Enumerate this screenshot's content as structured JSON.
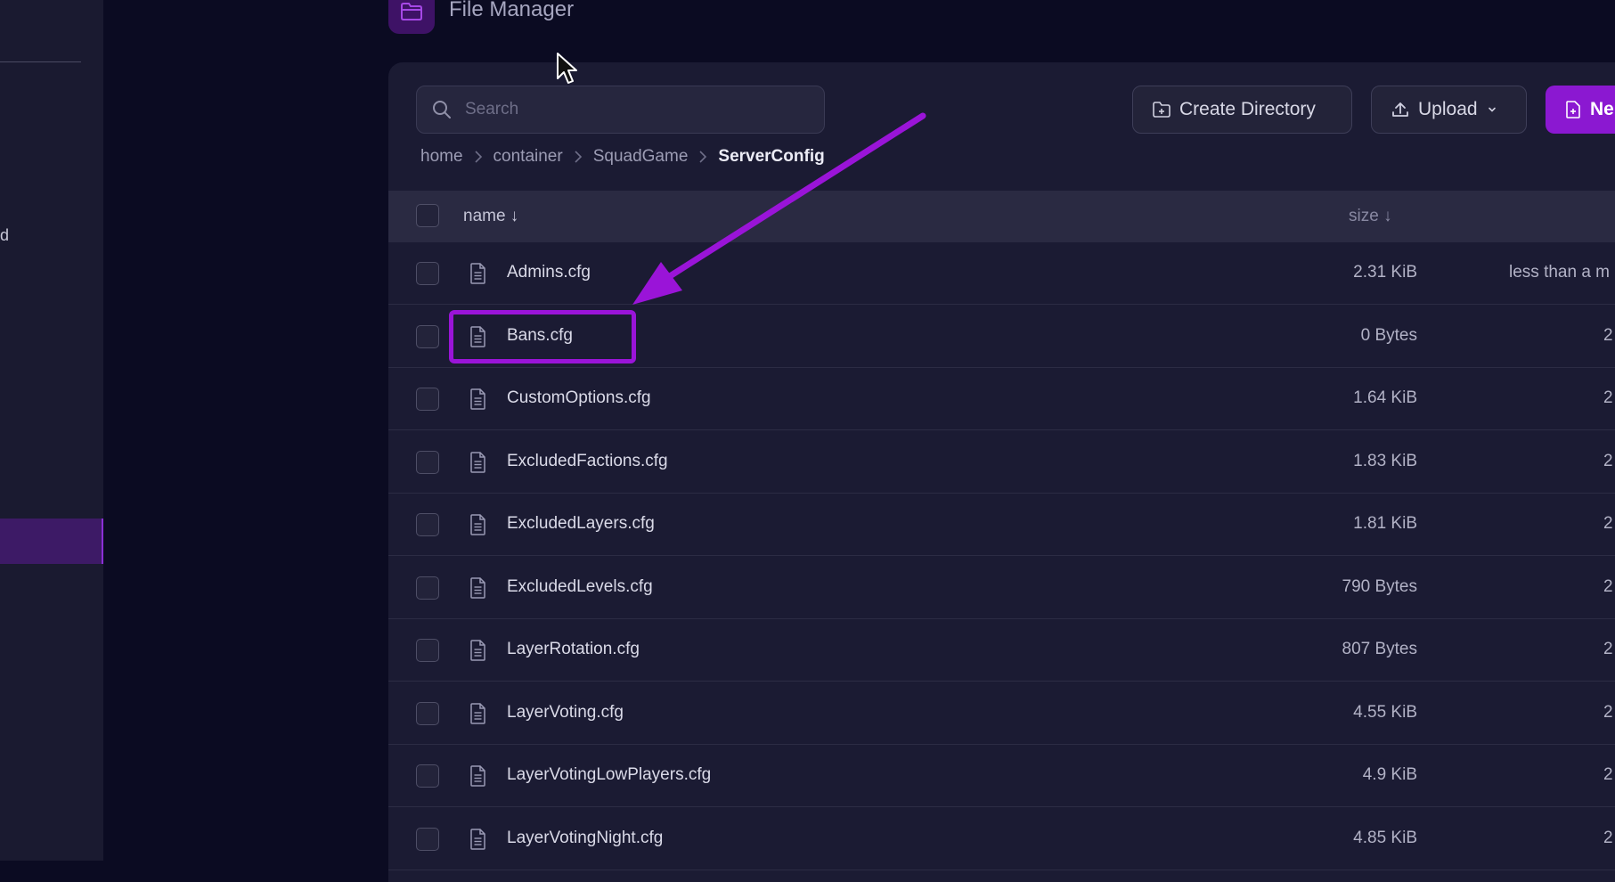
{
  "sidebar": {
    "fragment_text": "d"
  },
  "header": {
    "title": "File Manager"
  },
  "search": {
    "placeholder": "Search"
  },
  "toolbar": {
    "create_directory_label": "Create Directory",
    "upload_label": "Upload",
    "new_label": "Ne"
  },
  "breadcrumb": [
    "home",
    "container",
    "SquadGame",
    "ServerConfig"
  ],
  "table": {
    "headers": {
      "name": "name ↓",
      "size": "size ↓"
    },
    "rows": [
      {
        "name": "Admins.cfg",
        "size": "2.31 KiB",
        "modified": "less than a m"
      },
      {
        "name": "Bans.cfg",
        "size": "0 Bytes",
        "modified": "2"
      },
      {
        "name": "CustomOptions.cfg",
        "size": "1.64 KiB",
        "modified": "2"
      },
      {
        "name": "ExcludedFactions.cfg",
        "size": "1.83 KiB",
        "modified": "2"
      },
      {
        "name": "ExcludedLayers.cfg",
        "size": "1.81 KiB",
        "modified": "2"
      },
      {
        "name": "ExcludedLevels.cfg",
        "size": "790 Bytes",
        "modified": "2"
      },
      {
        "name": "LayerRotation.cfg",
        "size": "807 Bytes",
        "modified": "2"
      },
      {
        "name": "LayerVoting.cfg",
        "size": "4.55 KiB",
        "modified": "2"
      },
      {
        "name": "LayerVotingLowPlayers.cfg",
        "size": "4.9 KiB",
        "modified": "2"
      },
      {
        "name": "LayerVotingNight.cfg",
        "size": "4.85 KiB",
        "modified": "2"
      }
    ]
  },
  "annotation": {
    "highlighted_file": "Bans.cfg",
    "color": "#9a14d8"
  },
  "colors": {
    "accent": "#8b18d1",
    "background": "#0b0b22",
    "panel": "#1b1b33"
  }
}
